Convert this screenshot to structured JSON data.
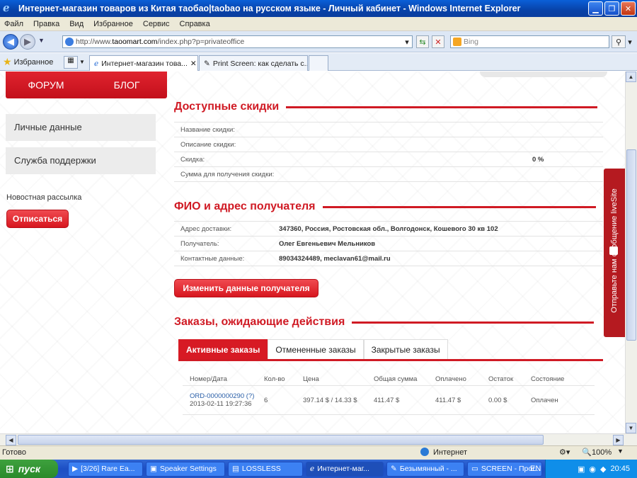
{
  "window": {
    "title": "Интернет-магазин товаров из Китая таобао|taobao на русском языке - Личный кабинет - Windows Internet Explorer"
  },
  "menu": [
    "Файл",
    "Правка",
    "Вид",
    "Избранное",
    "Сервис",
    "Справка"
  ],
  "address": {
    "prefix": "http://www.",
    "domain": "taoomart.com",
    "path": "/index.php?p=privateoffice",
    "search_placeholder": "Bing"
  },
  "favorites_label": "Избранное",
  "tabs": [
    {
      "label": "Интернет-магазин това..."
    },
    {
      "label": "Print Screen: как сделать с..."
    }
  ],
  "site_menu": {
    "forum": "ФОРУМ",
    "blog": "БЛОГ"
  },
  "sidebar": {
    "items": [
      {
        "label": "Личные данные"
      },
      {
        "label": "Служба поддержки"
      }
    ],
    "newsletter_label": "Новостная рассылка",
    "unsubscribe": "Отписаться"
  },
  "discounts": {
    "title": "Доступные скидки",
    "rows": [
      {
        "label": "Название скидки:",
        "value": ""
      },
      {
        "label": "Описание скидки:",
        "value": ""
      },
      {
        "label": "Скидка:",
        "value": "0 %"
      },
      {
        "label": "Сумма для получения скидки:",
        "value": ""
      }
    ]
  },
  "recipient": {
    "title": "ФИО и адрес получателя",
    "rows": [
      {
        "label": "Адрес доставки:",
        "value": "347360, Россия, Ростовская обл., Волгодонск, Кошевого 30 кв 102"
      },
      {
        "label": "Получатель:",
        "value": "Олег Евгеньевич Мельников"
      },
      {
        "label": "Контактные данные:",
        "value": "89034324489, meclavan61@mail.ru"
      }
    ],
    "edit_button": "Изменить данные получателя"
  },
  "orders": {
    "title": "Заказы, ожидающие действия",
    "tabs": [
      "Активные заказы",
      "Отмененные заказы",
      "Закрытые заказы"
    ],
    "columns": [
      "Номер/Дата",
      "Кол-во",
      "Цена",
      "Общая сумма",
      "Оплачено",
      "Остаток",
      "Состояние"
    ],
    "rows": [
      {
        "number": "ORD-0000000290",
        "help": "(?)",
        "date": "2013-02-11 19:27:36",
        "qty": "6",
        "price": "397.14 $ / 14.33 $",
        "total": "411.47 $",
        "paid": "411.47 $",
        "rest": "0.00 $",
        "state": "Оплачен"
      }
    ]
  },
  "livesite": "Отправьте нам сообщение liveSite",
  "status": {
    "text": "Готово",
    "zone": "Интернет",
    "zoom": "100%"
  },
  "taskbar": {
    "start": "пуск",
    "tasks": [
      "[3/26] Rare Ea...",
      "Speaker Settings",
      "LOSSLESS",
      "Интернет-маг...",
      "Безымянный - ...",
      "SCREEN - Прог..."
    ],
    "lang": "EN",
    "clock": "20:45"
  }
}
